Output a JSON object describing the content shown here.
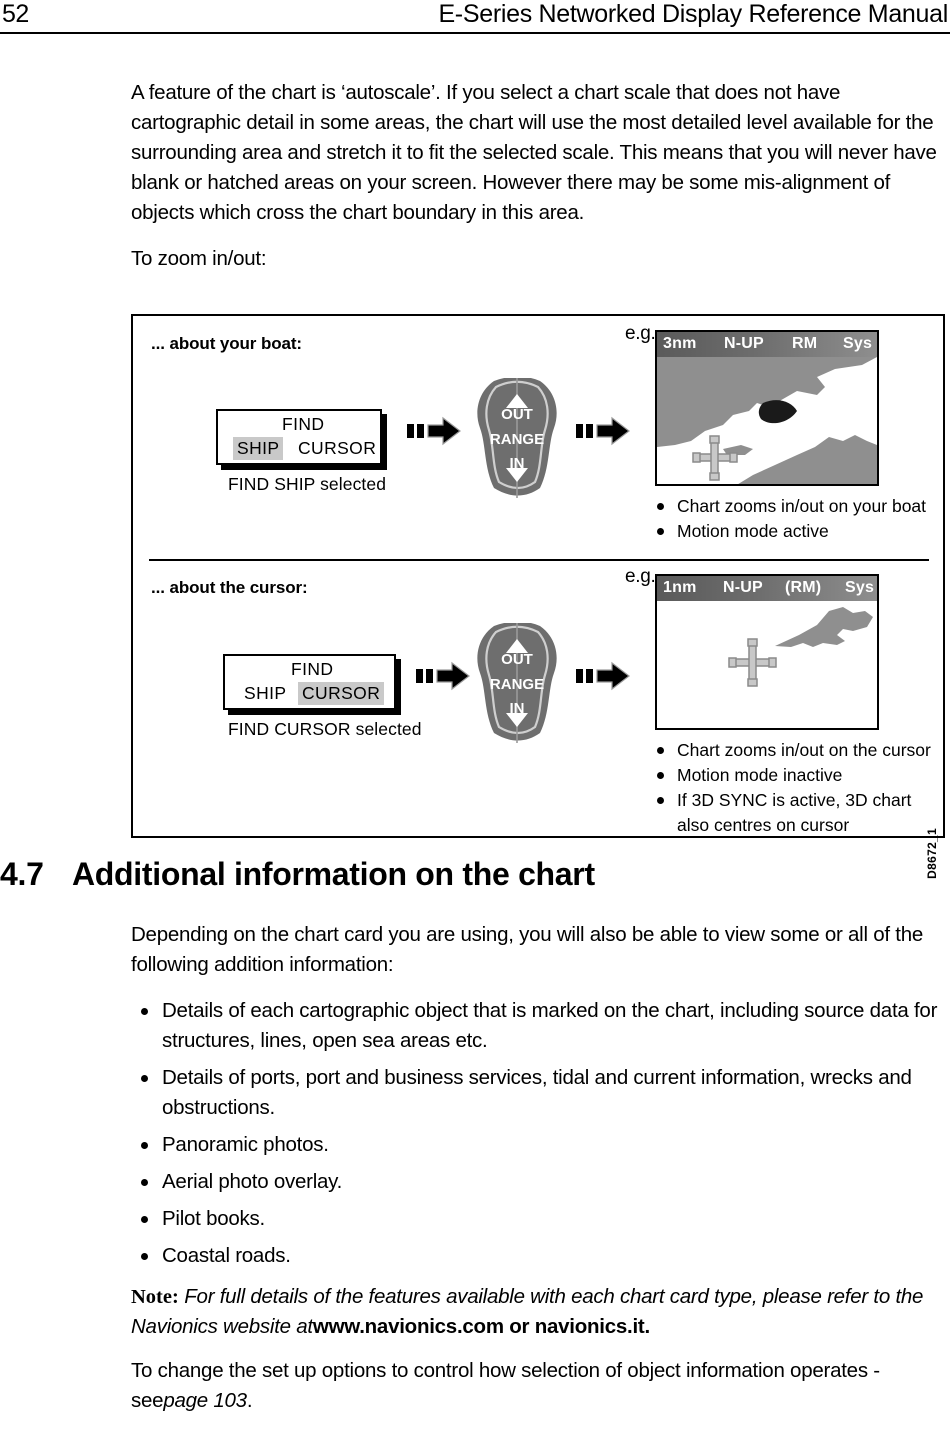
{
  "header": {
    "page_number": "52",
    "running_title": "E-Series Networked Display Reference Manual"
  },
  "intro": {
    "paragraph": "A feature of the chart is ‘autoscale’. If you select a chart scale that does not have cartographic detail in some areas, the chart will use the most detailed level available for the surrounding area and stretch it to fit the selected scale. This means that you will never have blank or hatched areas on your screen. However there may be some mis-alignment of objects which cross the chart boundary in this area.",
    "lead_in": "To zoom in/out:"
  },
  "figure": {
    "code": "D8672_1",
    "panels": [
      {
        "heading": "... about your boat:",
        "menu": {
          "find_label": "FIND",
          "option_left": "SHIP",
          "option_right": "CURSOR",
          "selected": "SHIP"
        },
        "caption": "FIND SHIP selected",
        "key": {
          "out": "OUT",
          "range": "RANGE",
          "in": "IN"
        },
        "eg_label": "e.g.",
        "display": {
          "range": "3nm",
          "orientation": "N-UP",
          "motion": "RM",
          "source": "Sys"
        },
        "bullets": [
          "Chart zooms in/out on your boat",
          "Motion mode active"
        ]
      },
      {
        "heading": "... about the cursor:",
        "menu": {
          "find_label": "FIND",
          "option_left": "SHIP",
          "option_right": "CURSOR",
          "selected": "CURSOR"
        },
        "caption": "FIND CURSOR selected",
        "key": {
          "out": "OUT",
          "range": "RANGE",
          "in": "IN"
        },
        "eg_label": "e.g.",
        "display": {
          "range": "1nm",
          "orientation": "N-UP",
          "motion": "(RM)",
          "source": "Sys"
        },
        "bullets": [
          "Chart zooms in/out on the cursor",
          "Motion mode inactive",
          "If 3D SYNC is active, 3D chart",
          "also centres on cursor"
        ]
      }
    ]
  },
  "section": {
    "number": "4.7",
    "title": "Additional information on the chart",
    "intro": "Depending on the chart card you are using, you will also be able to view some or all of the following addition information:",
    "list": [
      "Details of each cartographic object that is marked on the chart, including source data for structures, lines, open sea areas etc.",
      "Details of ports, port and business services, tidal and current information, wrecks and obstructions.",
      "Panoramic photos.",
      "Aerial photo overlay.",
      "Pilot books.",
      "Coastal roads."
    ],
    "note_label": "Note:",
    "note_body": "For full details of the features available with each chart card type, please refer to the Navionics website at",
    "note_url": "www.navionics.com or navionics.it.",
    "closing_before": "To change the set up options to control how selection of object information operates - see",
    "closing_xref": "page 103",
    "closing_after": "."
  },
  "colors": {
    "ink": "#000000",
    "land": "#8f8f8f",
    "key_body": "#6e6e6e",
    "menu_highlight": "#c9c9c9",
    "bar_dark": "#5a5a5a",
    "bar_light": "#8e8e8e"
  }
}
